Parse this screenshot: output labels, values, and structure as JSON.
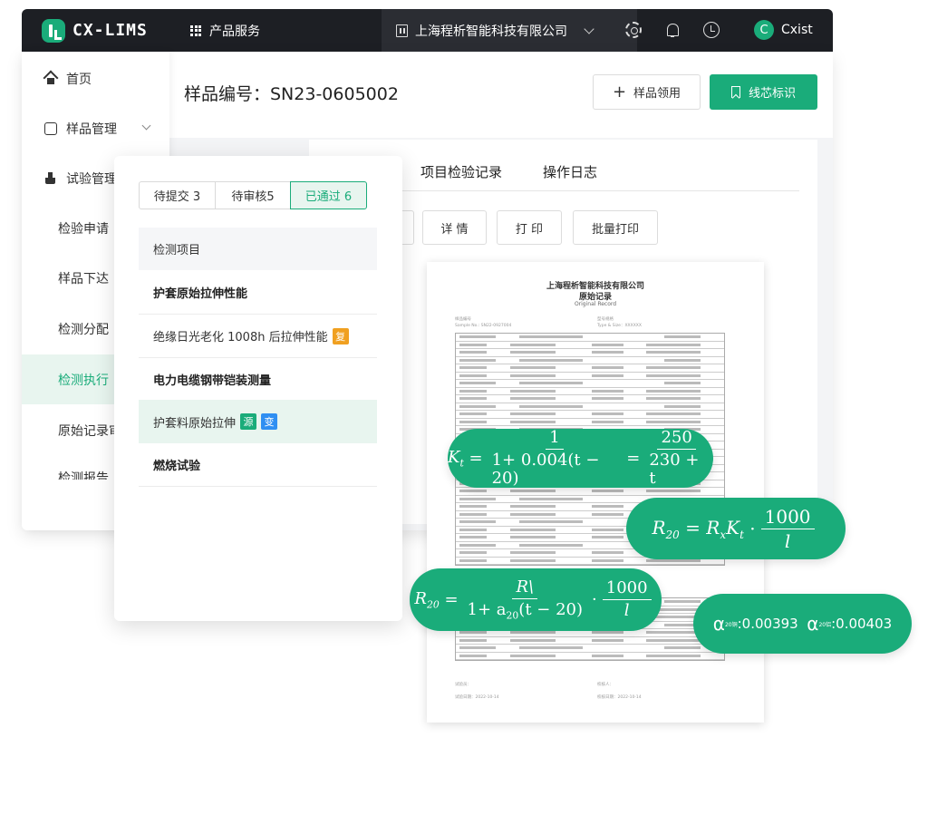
{
  "app": {
    "logo_text": "CX-LIMS",
    "products_label": "产品服务",
    "company_name": "上海程析智能科技有限公司",
    "user_initial": "C",
    "user_name": "Cxist",
    "accent_color": "#1aac7a"
  },
  "sidebar": {
    "items": [
      {
        "label": "首页",
        "icon": "home-icon"
      },
      {
        "label": "样品管理",
        "icon": "box-icon"
      },
      {
        "label": "试验管理",
        "icon": "flask-icon"
      },
      {
        "label": "检验申请"
      },
      {
        "label": "样品下达"
      },
      {
        "label": "检测分配"
      },
      {
        "label": "检测执行",
        "active": true
      },
      {
        "label": "原始记录审"
      },
      {
        "label": "检测报告"
      }
    ]
  },
  "header": {
    "sample_title": "样品编号：SN23-0605002",
    "receive_button": "样品领用",
    "mark_button": "线芯标识"
  },
  "content": {
    "tabs": [
      "项目检验记录",
      "操作日志"
    ],
    "buttons": [
      "详 情",
      "打 印",
      "批量打印"
    ]
  },
  "document": {
    "company": "上海程析智能科技有限公司",
    "title": "原始记录",
    "subtitle": "Original Record",
    "sample_no": "样品编号\nSample No.: SN22-0927004",
    "type_size": "型号规格\nType & Size：XXXXXX",
    "footer_tester": "试验员：",
    "footer_date": "试验日期：2022-10-14",
    "footer_checker": "校核人：",
    "footer_check_date": "校核日期：2022-10-14"
  },
  "float_panel": {
    "status_tabs": [
      {
        "label": "待提交 3",
        "active": false
      },
      {
        "label": "待审核5",
        "active": false
      },
      {
        "label": "已通过 6",
        "active": true
      }
    ],
    "list_header": "检测项目",
    "items": [
      {
        "label": "护套原始拉伸性能",
        "bold": true,
        "tags": []
      },
      {
        "label": "绝缘日光老化 1008h 后拉伸性能",
        "bold": false,
        "tags": [
          {
            "text": "复",
            "color": "#f0a020"
          }
        ]
      },
      {
        "label": "电力电缆钢带铠装测量",
        "bold": true,
        "tags": []
      },
      {
        "label": "护套料原始拉伸",
        "bold": false,
        "selected": true,
        "tags": [
          {
            "text": "源",
            "color": "#1aac7a"
          },
          {
            "text": "变",
            "color": "#2f8ff2"
          }
        ]
      },
      {
        "label": "燃烧试验",
        "bold": true,
        "tags": []
      }
    ]
  },
  "formulas": {
    "kt": {
      "lhs": "K",
      "lhs_sub": "t",
      "num1": "1",
      "den1": "1+ 0.004(t − 20)",
      "num2": "250",
      "den2": "230 + t"
    },
    "r20_a": {
      "lhs": "R",
      "lhs_sub": "20",
      "rhs": "= R",
      "rx_sub": "x",
      "kt": "K",
      "kt_sub": "t",
      "num": "1000",
      "den": "l"
    },
    "r20_b": {
      "lhs": "R",
      "lhs_sub": "20",
      "num1": "R\\",
      "den1": "1+ a",
      "den1_sub": "20",
      "den1_rest": "(t − 20)",
      "num2": "1000",
      "den2": "l"
    },
    "alpha": {
      "a1_symbol": "α",
      "a1_sub": "20铜",
      "a1_value": ":0.00393",
      "a2_symbol": "α",
      "a2_sub": "20铝",
      "a2_value": ":0.00403"
    }
  }
}
